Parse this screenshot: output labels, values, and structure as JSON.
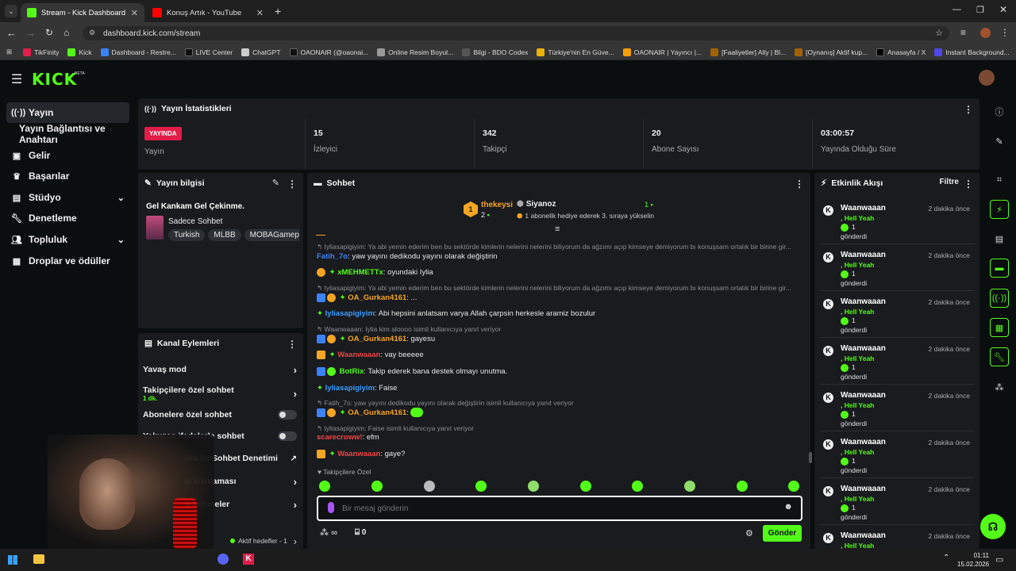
{
  "browser": {
    "tabs": [
      {
        "title": "Stream - Kick Dashboard"
      },
      {
        "title": "Konuş Artık - YouTube"
      }
    ],
    "url": "dashboard.kick.com/stream",
    "bookmarks": [
      "TikFinity",
      "Kick",
      "Dashboard - Restre...",
      "LIVE Center",
      "ChatGPT",
      "OAONAIR (@oaonai...",
      "Online Resim Boyut...",
      "Bilgi - BDO Codex",
      "Türkiye'nin En Güve...",
      "OAONAIR | Yayıncı |...",
      "[Faaliyetler] Ally | Bl...",
      "[Oynanış] Aktif kup...",
      "Anasayfa / X",
      "Instant Background..."
    ]
  },
  "logo": "KICK",
  "logo_badge": "BETA",
  "sidebar": {
    "items": [
      {
        "label": "Yayın"
      },
      {
        "label": "Yayın Bağlantısı ve Anahtarı"
      },
      {
        "label": "Gelir"
      },
      {
        "label": "Başarılar"
      },
      {
        "label": "Stüdyo"
      },
      {
        "label": "Denetleme"
      },
      {
        "label": "Topluluk"
      },
      {
        "label": "Droplar ve ödüller"
      }
    ]
  },
  "stats": {
    "title": "Yayın İstatistikleri",
    "live_badge": "YAYINDA",
    "live_label": "Yayın",
    "items": [
      {
        "value": "15",
        "label": "İzleyici"
      },
      {
        "value": "342",
        "label": "Takipçi"
      },
      {
        "value": "20",
        "label": "Abone Sayısı"
      },
      {
        "value": "03:00:57",
        "label": "Yayında Olduğu Süre"
      }
    ]
  },
  "stream_info": {
    "title": "Yayın bilgisi",
    "stream_title": "Gel Kankam Gel Çekinme.",
    "category": "Sadece Sohbet",
    "tags": [
      "Turkish",
      "MLBB",
      "MOBAGamepla"
    ]
  },
  "channel_actions": {
    "title": "Kanal Eylemleri",
    "items": [
      {
        "label": "Yavaş mod"
      },
      {
        "label": "Takipçilere özel sohbet",
        "sub": "1 dk."
      },
      {
        "label": "Abonelere özel sohbet"
      },
      {
        "label": "Yalnızca ifadelerle sohbet"
      },
      {
        "label": "eka ile Sohbet Denetimi"
      },
      {
        "label": "şı kısıtlaması"
      },
      {
        "label": "ış kelimeler"
      }
    ],
    "footer": "Aktif hedefler - 1"
  },
  "chat": {
    "title": "Sohbet",
    "pinned": {
      "user": "thekeysi",
      "rank": "1",
      "count": "2",
      "gift_user": "Siyanoz",
      "gift_count": "1",
      "gift_text": "1 abonelik hediye ederek 3. sıraya yükselin"
    },
    "messages": [
      {
        "reply": "Iyliasapigiyim: Ya abi yemin ederim ben bu sektörde kimlerin nelerini nelerini biliyorum da ağzımı açıp kimseye demiyorum bı konuşsam ortalık bir birine gir..."
      },
      {
        "user": "Fatih_7o",
        "color": "#3b82f6",
        "text": "yaw yayını dedikodu yayını olarak değiştirin"
      },
      {
        "user": "xMEHMETTx",
        "color": "#53fc18",
        "text": "oyundaki Iylia"
      },
      {
        "reply": "Iyliasapigiyim: Ya abi yemin ederim ben bu sektörde kimlerin nelerini nelerini biliyorum da ağzımı açıp kimseye demiyorum bı konuşsam ortalık bir birine gir..."
      },
      {
        "user": "OA_Gurkan4161",
        "color": "#f5a524",
        "text": "..."
      },
      {
        "user": "Iyliasapigiyim",
        "color": "#3b9dff",
        "text": "Abi hepsini anlatsam varya Allah çarpsin herkesle aramiz bozulur"
      },
      {
        "reply": "Waanwaaan: Iylia kim aloooo isimli kullanıcıya yanıt veriyor"
      },
      {
        "user": "OA_Gurkan4161",
        "color": "#f5a524",
        "text": "gayesu"
      },
      {
        "user": "Waanwaaan",
        "color": "#ef4444",
        "text": "vay beeeee"
      },
      {
        "user": "BotRix",
        "color": "#53fc18",
        "text": "Takip ederek bana destek olmayı unutma."
      },
      {
        "user": "Iyliasapigiyim",
        "color": "#3b9dff",
        "text": "Faise"
      },
      {
        "reply": "Fatih_7o: yaw yayını dedikodu yayını olarak değiştirin isimli kullanıcıya yanıt veriyor"
      },
      {
        "user": "OA_Gurkan4161",
        "color": "#f5a524",
        "text": ""
      },
      {
        "reply": "Iyliasapigiyim: Faise isimli kullanıcıya yanıt veriyor"
      },
      {
        "user": "scarecroww!",
        "color": "#ef4444",
        "text": "efm"
      },
      {
        "user": "Waanwaaan",
        "color": "#ef4444",
        "text": "gaye?"
      }
    ],
    "followers_only": "Takipçilere Özel",
    "input_placeholder": "Bir mesaj gönderin",
    "points": "∞",
    "gifts": "0",
    "send_label": "Gönder"
  },
  "events": {
    "title": "Etkinlik Akışı",
    "filter_label": "Filtre",
    "items": [
      {
        "user": "Waanwaaan",
        "time": "2 dakika önce",
        "reward": ", Hell Yeah",
        "count": "1",
        "sent": "gönderdi"
      },
      {
        "user": "Waanwaaan",
        "time": "2 dakika önce",
        "reward": ", Hell Yeah",
        "count": "1",
        "sent": "gönderdi"
      },
      {
        "user": "Waanwaaan",
        "time": "2 dakika önce",
        "reward": ", Hell Yeah",
        "count": "1",
        "sent": "gönderdi"
      },
      {
        "user": "Waanwaaan",
        "time": "2 dakika önce",
        "reward": ", Hell Yeah",
        "count": "1",
        "sent": "gönderdi"
      },
      {
        "user": "Waanwaaan",
        "time": "2 dakika önce",
        "reward": ", Hell Yeah",
        "count": "1",
        "sent": "gönderdi"
      },
      {
        "user": "Waanwaaan",
        "time": "2 dakika önce",
        "reward": ", Hell Yeah",
        "count": "1",
        "sent": "gönderdi"
      },
      {
        "user": "Waanwaaan",
        "time": "2 dakika önce",
        "reward": ", Hell Yeah",
        "count": "1",
        "sent": "gönderdi"
      },
      {
        "user": "Waanwaaan",
        "time": "2 dakika önce",
        "reward": ", Hell Yeah",
        "count": "",
        "sent": ""
      }
    ]
  },
  "taskbar": {
    "time": "01:11",
    "date": "15.02.2026"
  },
  "colors": {
    "accent": "#53fc18",
    "bg": "#0b0e0f",
    "panel": "#191b1f",
    "live": "#e11d48"
  }
}
